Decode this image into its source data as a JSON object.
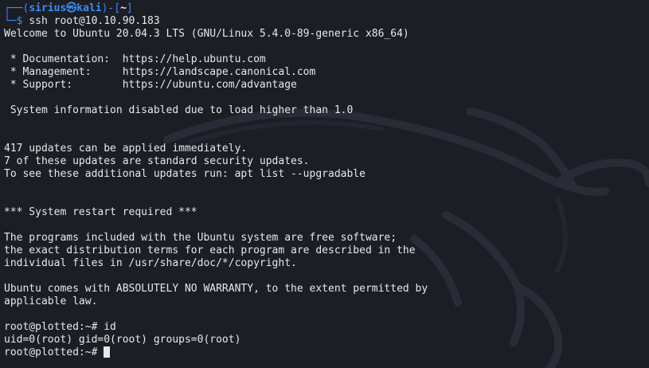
{
  "prompt": {
    "open": "┌──(",
    "user": "sirius",
    "at": "㉿",
    "host": "kali",
    "mid": ")-[",
    "path": "~",
    "close": "]",
    "arrow": "└─$",
    "command": "ssh root@10.10.90.183"
  },
  "output": [
    "Welcome to Ubuntu 20.04.3 LTS (GNU/Linux 5.4.0-89-generic x86_64)",
    "",
    " * Documentation:  https://help.ubuntu.com",
    " * Management:     https://landscape.canonical.com",
    " * Support:        https://ubuntu.com/advantage",
    "",
    " System information disabled due to load higher than 1.0",
    "",
    "",
    "417 updates can be applied immediately.",
    "7 of these updates are standard security updates.",
    "To see these additional updates run: apt list --upgradable",
    "",
    "",
    "*** System restart required ***",
    "",
    "The programs included with the Ubuntu system are free software;",
    "the exact distribution terms for each program are described in the",
    "individual files in /usr/share/doc/*/copyright.",
    "",
    "Ubuntu comes with ABSOLUTELY NO WARRANTY, to the extent permitted by",
    "applicable law.",
    "",
    "root@plotted:~# id",
    "uid=0(root) gid=0(root) groups=0(root)"
  ],
  "last_prompt": "root@plotted:~# ",
  "icons": {
    "background": "kali-dragon-icon"
  }
}
